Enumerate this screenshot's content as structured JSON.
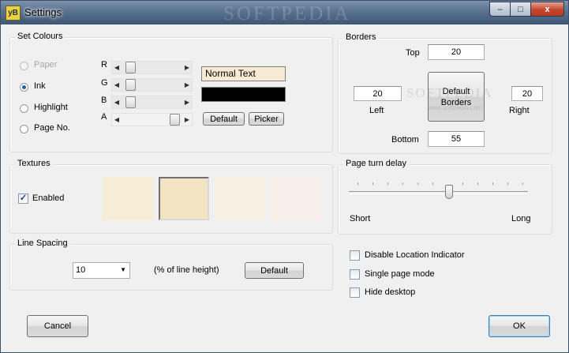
{
  "window": {
    "title": "Settings",
    "app_icon_text": "yB",
    "watermark": "SOFTPEDIA",
    "controls": {
      "minimize": "–",
      "maximize": "□",
      "close": "x"
    }
  },
  "set_colours": {
    "title": "Set Colours",
    "options": [
      {
        "label": "Paper",
        "selected": false,
        "enabled": false
      },
      {
        "label": "Ink",
        "selected": true,
        "enabled": true
      },
      {
        "label": "Highlight",
        "selected": false,
        "enabled": true
      },
      {
        "label": "Page No.",
        "selected": false,
        "enabled": true
      }
    ],
    "channels": [
      {
        "label": "R",
        "value_fraction": 0.08
      },
      {
        "label": "G",
        "value_fraction": 0.08
      },
      {
        "label": "B",
        "value_fraction": 0.08
      },
      {
        "label": "A",
        "value_fraction": 0.95
      }
    ],
    "preview_text": "Normal Text",
    "preview_paper_color": "#f7ebd3",
    "preview_ink_color": "#000000",
    "default_button": "Default",
    "picker_button": "Picker"
  },
  "borders": {
    "title": "Borders",
    "top_label": "Top",
    "top_value": "20",
    "left_label": "Left",
    "left_value": "20",
    "right_label": "Right",
    "right_value": "20",
    "bottom_label": "Bottom",
    "bottom_value": "55",
    "default_button": "Default Borders",
    "watermark": "SOFTPEDIA",
    "watermark_url": "www.softpedia.com"
  },
  "textures": {
    "title": "Textures",
    "enabled_label": "Enabled",
    "enabled": true,
    "swatch_colors": [
      "#f6edd6",
      "#f3e4c4",
      "#f7f1e4",
      "#f6efe7"
    ],
    "selected_index": 1
  },
  "page_turn_delay": {
    "title": "Page turn delay",
    "min_label": "Short",
    "max_label": "Long",
    "value_fraction": 0.56
  },
  "line_spacing": {
    "title": "Line Spacing",
    "value": "10",
    "unit_label": "(% of line height)",
    "default_button": "Default"
  },
  "options": {
    "disable_location": {
      "label": "Disable Location Indicator",
      "checked": false
    },
    "single_page": {
      "label": "Single page mode",
      "checked": false
    },
    "hide_desktop": {
      "label": "Hide desktop",
      "checked": false
    }
  },
  "footer": {
    "cancel_button": "Cancel",
    "ok_button": "OK"
  },
  "colors": {
    "accent": "#3c7fb1",
    "title_bar": "#4a6482",
    "close_button": "#c7452c"
  }
}
